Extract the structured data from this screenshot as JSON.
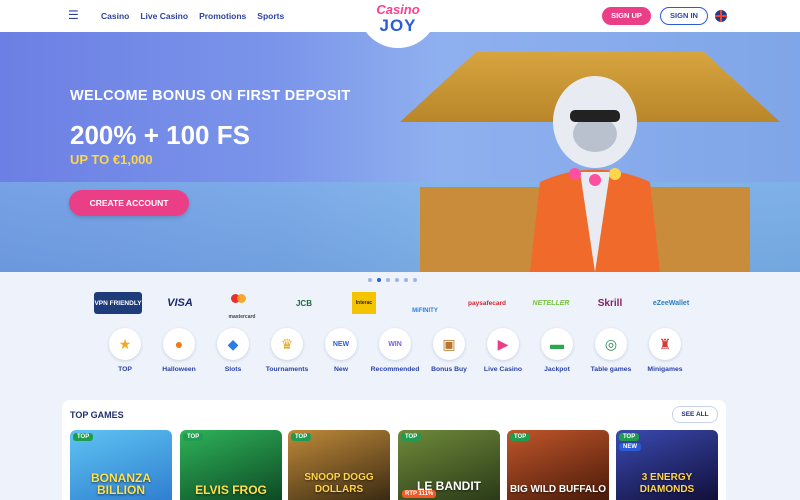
{
  "header": {
    "nav": [
      "Casino",
      "Live Casino",
      "Promotions",
      "Sports"
    ],
    "logo_top": "Casino",
    "logo_bottom": "JOY",
    "signup_label": "SIGN UP",
    "signin_label": "SIGN IN"
  },
  "hero": {
    "subtitle": "WELCOME BONUS ON FIRST DEPOSIT",
    "title": "200% + 100 FS",
    "upto": "UP TO €1,000",
    "cta_label": "CREATE ACCOUNT",
    "slides_count": 6,
    "active_slide": 2
  },
  "payments": [
    {
      "name": "VPN FRIENDLY",
      "color": "#1f3c7a"
    },
    {
      "name": "VISA",
      "color": "#1a2a6c"
    },
    {
      "name": "mastercard",
      "color": "#e8312c"
    },
    {
      "name": "JCB",
      "color": "#1a6b3a"
    },
    {
      "name": "Interac",
      "color": "#f5c400"
    },
    {
      "name": "MiFINITY",
      "color": "#2c7be5"
    },
    {
      "name": "paysafecard",
      "color": "#d8232a"
    },
    {
      "name": "NETELLER",
      "color": "#79c143"
    },
    {
      "name": "Skrill",
      "color": "#862165"
    },
    {
      "name": "eZeeWallet",
      "color": "#2b7bb9"
    }
  ],
  "categories": [
    {
      "label": "TOP",
      "icon": "star-icon"
    },
    {
      "label": "Halloween",
      "icon": "pumpkin-icon"
    },
    {
      "label": "Slots",
      "icon": "slot-icon"
    },
    {
      "label": "Tournaments",
      "icon": "trophy-icon"
    },
    {
      "label": "New",
      "icon": "new-icon"
    },
    {
      "label": "Recommended",
      "icon": "win-icon"
    },
    {
      "label": "Bonus Buy",
      "icon": "treasure-chest-icon"
    },
    {
      "label": "Live Casino",
      "icon": "play-icon"
    },
    {
      "label": "Jackpot",
      "icon": "cash-icon"
    },
    {
      "label": "Table games",
      "icon": "roulette-icon"
    },
    {
      "label": "Minigames",
      "icon": "joystick-icon"
    }
  ],
  "top_games": {
    "title": "TOP GAMES",
    "see_all": "SEE ALL",
    "games": [
      {
        "name": "BONANZA BILLION",
        "badge": "TOP",
        "color": "#3aa0e0"
      },
      {
        "name": "ELVIS FROG",
        "badge": "TOP",
        "color": "#1a7a3a"
      },
      {
        "name": "SNOOP DOGG DOLLARS",
        "badge": "TOP",
        "color": "#6b4a1f"
      },
      {
        "name": "LE BANDIT",
        "badge": "TOP",
        "rtp": "RTP 111%",
        "color": "#4a5a2a"
      },
      {
        "name": "BIG WILD BUFFALO",
        "badge": "TOP",
        "color": "#8a3a1a"
      },
      {
        "name": "3 ENERGY DIAMONDS",
        "badge": "TOP",
        "badge2": "NEW",
        "color": "#2a2a6a"
      }
    ]
  }
}
